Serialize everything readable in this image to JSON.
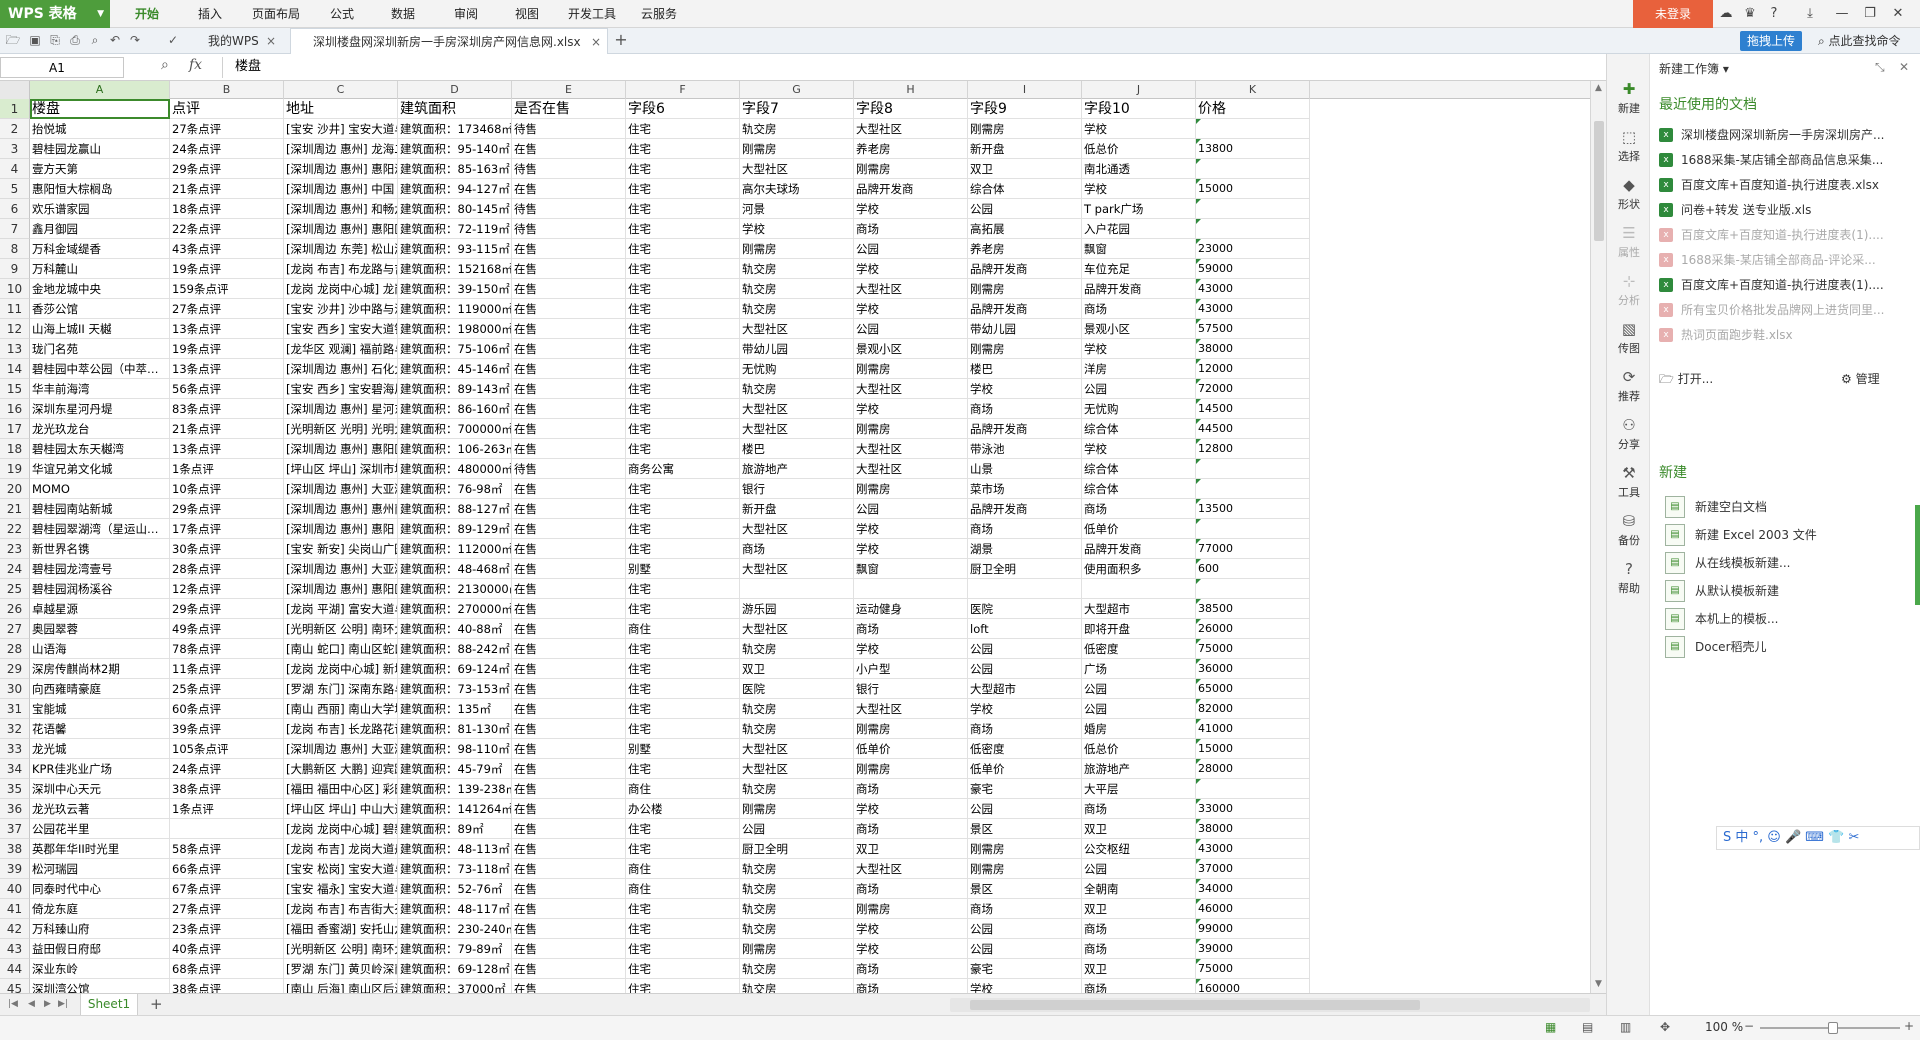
{
  "app": {
    "name": "WPS 表格",
    "login": "未登录",
    "upload": "拖拽上传",
    "find_cmd": "点此查找命令"
  },
  "menus": [
    "开始",
    "插入",
    "页面布局",
    "公式",
    "数据",
    "审阅",
    "视图",
    "开发工具",
    "云服务"
  ],
  "tabs": [
    {
      "label": "我的WPS"
    },
    {
      "label": "深圳楼盘网深圳新房一手房深圳房产网信息网.xlsx"
    }
  ],
  "formula": {
    "cell": "A1",
    "fx": "fx",
    "value": "楼盘"
  },
  "columns": [
    "A",
    "B",
    "C",
    "D",
    "E",
    "F",
    "G",
    "H",
    "I",
    "J",
    "K"
  ],
  "header_row": [
    "楼盘",
    "点评",
    "地址",
    "建筑面积",
    "是否在售",
    "字段6",
    "字段7",
    "字段8",
    "字段9",
    "字段10",
    "价格"
  ],
  "rows": [
    [
      "抬悦城",
      "27条点评",
      "[宝安 沙井] 宝安大道与创",
      "建筑面积：173468㎡",
      "待售",
      "住宅",
      "轨交房",
      "大型社区",
      "刚需房",
      "学校",
      ""
    ],
    [
      "碧桂园龙赢山",
      "24条点评",
      "[深圳周边 惠州] 龙海二路",
      "建筑面积：95-140㎡",
      "在售",
      "住宅",
      "刚需房",
      "养老房",
      "新开盘",
      "低总价",
      "13800"
    ],
    [
      "壹方天第",
      "29条点评",
      "[深圳周边 惠州] 惠阳淡水",
      "建筑面积：85-163㎡",
      "待售",
      "住宅",
      "大型社区",
      "刚需房",
      "双卫",
      "南北通透",
      ""
    ],
    [
      "惠阳恒大棕榈岛",
      "21条点评",
      "[深圳周边 惠州] 中国 惠阳",
      "建筑面积：94-127㎡",
      "在售",
      "住宅",
      "高尔夫球场",
      "品牌开发商",
      "综合体",
      "学校",
      "15000"
    ],
    [
      "欢乐谱家园",
      "18条点评",
      "[深圳周边 惠州] 和畅六路",
      "建筑面积：80-145㎡",
      "待售",
      "住宅",
      "河景",
      "学校",
      "公园",
      "T park广场",
      ""
    ],
    [
      "鑫月御园",
      "22条点评",
      "[深圳周边 惠州] 惠阳区北",
      "建筑面积：72-119㎡",
      "待售",
      "住宅",
      "学校",
      "商场",
      "高拓展",
      "入户花园",
      ""
    ],
    [
      "万科金域缇香",
      "43条点评",
      "[深圳周边 东莞] 松山湖科",
      "建筑面积：93-115㎡",
      "在售",
      "住宅",
      "刚需房",
      "公园",
      "养老房",
      "飘窗",
      "23000"
    ],
    [
      "万科麓山",
      "19条点评",
      "[龙岗 布吉] 布龙路与吉华",
      "建筑面积：152168㎡",
      "在售",
      "住宅",
      "轨交房",
      "学校",
      "品牌开发商",
      "车位充足",
      "59000"
    ],
    [
      "金地龙城中央",
      "159条点评",
      "[龙岗 龙岗中心城] 龙岗大",
      "建筑面积：39-150㎡",
      "在售",
      "住宅",
      "轨交房",
      "大型社区",
      "刚需房",
      "品牌开发商",
      "43000"
    ],
    [
      "香莎公馆",
      "27条点评",
      "[宝安 沙井] 沙中路与沙井",
      "建筑面积：119000㎡",
      "在售",
      "住宅",
      "轨交房",
      "学校",
      "品牌开发商",
      "商场",
      "43000"
    ],
    [
      "山海上城II 天樾",
      "13条点评",
      "[宝安 西乡] 宝安大道铁仔",
      "建筑面积：198000㎡",
      "在售",
      "住宅",
      "大型社区",
      "公园",
      "带幼儿园",
      "景观小区",
      "57500"
    ],
    [
      "珑门名苑",
      "19条点评",
      "[龙华区 观澜] 福前路与观",
      "建筑面积：75-106㎡",
      "在售",
      "住宅",
      "带幼儿园",
      "景观小区",
      "刚需房",
      "学校",
      "38000"
    ],
    [
      "碧桂园中萃公园（中萃…",
      "13条点评",
      "[深圳周边 惠州] 石化大道",
      "建筑面积：45-146㎡",
      "在售",
      "住宅",
      "无忧购",
      "刚需房",
      "楼巴",
      "洋房",
      "12000"
    ],
    [
      "华丰前海湾",
      "56条点评",
      "[宝安 西乡] 宝安碧海片区",
      "建筑面积：89-143㎡",
      "在售",
      "住宅",
      "轨交房",
      "大型社区",
      "学校",
      "公园",
      "72000"
    ],
    [
      "深圳东星河丹堤",
      "83条点评",
      "[深圳周边 惠州] 星河东七",
      "建筑面积：86-160㎡",
      "在售",
      "住宅",
      "大型社区",
      "学校",
      "商场",
      "无忧购",
      "14500"
    ],
    [
      "龙光玖龙台",
      "21条点评",
      "[光明新区 光明] 光明大道",
      "建筑面积：700000㎡",
      "在售",
      "住宅",
      "大型社区",
      "刚需房",
      "品牌开发商",
      "综合体",
      "44500"
    ],
    [
      "碧桂园太东天樾湾",
      "13条点评",
      "[深圳周边 惠州] 惠阳区大",
      "建筑面积：106-263㎡",
      "在售",
      "住宅",
      "楼巴",
      "大型社区",
      "带泳池",
      "学校",
      "12800"
    ],
    [
      "华谊兄弟文化城",
      "1条点评",
      "[坪山区 坪山] 深圳市坪山",
      "建筑面积：480000㎡",
      "待售",
      "商务公寓",
      "旅游地产",
      "大型社区",
      "山景",
      "综合体",
      ""
    ],
    [
      "MOMO",
      "10条点评",
      "[深圳周边 惠州] 大亚湾区",
      "建筑面积：76-98㎡",
      "在售",
      "住宅",
      "银行",
      "刚需房",
      "菜市场",
      "综合体",
      ""
    ],
    [
      "碧桂园南站新城",
      "29条点评",
      "[深圳周边 惠州] 惠州南站",
      "建筑面积：88-127㎡",
      "在售",
      "住宅",
      "新开盘",
      "公园",
      "品牌开发商",
      "商场",
      "13500"
    ],
    [
      "碧桂园翠湖湾（星运山…",
      "17条点评",
      "[深圳周边 惠州] 惠阳 新圩",
      "建筑面积：89-129㎡",
      "在售",
      "住宅",
      "大型社区",
      "学校",
      "商场",
      "低单价",
      ""
    ],
    [
      "新世界名镌",
      "30条点评",
      "[宝安 新安] 尖岗山广园路",
      "建筑面积：112000㎡",
      "在售",
      "住宅",
      "商场",
      "学校",
      "湖景",
      "品牌开发商",
      "77000"
    ],
    [
      "碧桂园龙湾壹号",
      "28条点评",
      "[深圳周边 惠州] 大亚湾西",
      "建筑面积：48-468㎡",
      "在售",
      "别墅",
      "大型社区",
      "飘窗",
      "厨卫全明",
      "使用面积多",
      "600"
    ],
    [
      "碧桂园润杨溪谷",
      "12条点评",
      "[深圳周边 惠州] 惠阳区深",
      "建筑面积：2130000㎡",
      "在售",
      "住宅",
      "",
      "",
      "",
      "",
      ""
    ],
    [
      "卓越星源",
      "29条点评",
      "[龙岗 平湖] 富安大道与新",
      "建筑面积：270000㎡",
      "在售",
      "住宅",
      "游乐园",
      "运动健身",
      "医院",
      "大型超市",
      "38500"
    ],
    [
      "奥园翠蓉",
      "49条点评",
      "[光明新区 公明] 南环大道",
      "建筑面积：40-88㎡",
      "在售",
      "商住",
      "大型社区",
      "商场",
      "loft",
      "即将开盘",
      "26000"
    ],
    [
      "山语海",
      "78条点评",
      "[南山 蛇口] 南山区蛇口沿",
      "建筑面积：88-242㎡",
      "在售",
      "住宅",
      "轨交房",
      "学校",
      "公园",
      "低密度",
      "75000"
    ],
    [
      "深房传麒尚林2期",
      "11条点评",
      "[龙岗 龙岗中心城] 新城路",
      "建筑面积：69-124㎡",
      "在售",
      "住宅",
      "双卫",
      "小户型",
      "公园",
      "广场",
      "36000"
    ],
    [
      "向西雍晴豪庭",
      "25条点评",
      "[罗湖 东门] 深南东路与东",
      "建筑面积：73-153㎡",
      "在售",
      "住宅",
      "医院",
      "银行",
      "大型超市",
      "公园",
      "65000"
    ],
    [
      "宝能城",
      "60条点评",
      "[南山 西丽] 南山大学城地",
      "建筑面积：135㎡",
      "在售",
      "住宅",
      "轨交房",
      "大型社区",
      "学校",
      "公园",
      "82000"
    ],
    [
      "花语馨",
      "39条点评",
      "[龙岗 布吉] 长龙路花语路",
      "建筑面积：81-130㎡",
      "在售",
      "住宅",
      "轨交房",
      "刚需房",
      "商场",
      "婚房",
      "41000"
    ],
    [
      "龙光城",
      "105条点评",
      "[深圳周边 惠州] 大亚湾西",
      "建筑面积：98-110㎡",
      "在售",
      "别墅",
      "大型社区",
      "低单价",
      "低密度",
      "低总价",
      "15000"
    ],
    [
      "KPR佳兆业广场",
      "24条点评",
      "[大鹏新区 大鹏] 迎宾路与",
      "建筑面积：45-79㎡",
      "在售",
      "住宅",
      "大型社区",
      "刚需房",
      "低单价",
      "旅游地产",
      "28000"
    ],
    [
      "深圳中心天元",
      "38条点评",
      "[福田 福田中心区] 彩田路",
      "建筑面积：139-238㎡",
      "在售",
      "商住",
      "轨交房",
      "商场",
      "豪宅",
      "大平层",
      ""
    ],
    [
      "龙光玖云著",
      "1条点评",
      "[坪山区 坪山] 中山大道与",
      "建筑面积：141264㎡",
      "在售",
      "办公楼",
      "刚需房",
      "学校",
      "公园",
      "商场",
      "33000"
    ],
    [
      "公园花半里",
      "",
      "[龙岗 龙岗中心城] 碧新路",
      "建筑面积：89㎡",
      "在售",
      "住宅",
      "公园",
      "商场",
      "景区",
      "双卫",
      "38000"
    ],
    [
      "英郡年华II时光里",
      "58条点评",
      "[龙岗 布吉] 龙岗大道丹竹",
      "建筑面积：48-113㎡",
      "在售",
      "住宅",
      "厨卫全明",
      "双卫",
      "刚需房",
      "公交枢纽",
      "43000"
    ],
    [
      "松河瑞园",
      "66条点评",
      "[宝安 松岗] 宝安大道与河",
      "建筑面积：73-118㎡",
      "在售",
      "商住",
      "轨交房",
      "大型社区",
      "刚需房",
      "公园",
      "37000"
    ],
    [
      "同泰时代中心",
      "67条点评",
      "[宝安 福永] 宝安大道与福",
      "建筑面积：52-76㎡",
      "在售",
      "商住",
      "轨交房",
      "商场",
      "景区",
      "全朝南",
      "34000"
    ],
    [
      "倚龙东庭",
      "27条点评",
      "[龙岗 布吉] 布吉街大芬村",
      "建筑面积：48-117㎡",
      "在售",
      "住宅",
      "轨交房",
      "刚需房",
      "商场",
      "双卫",
      "46000"
    ],
    [
      "万科臻山府",
      "23条点评",
      "[福田 香蜜湖] 安托山六路",
      "建筑面积：230-240㎡",
      "在售",
      "住宅",
      "轨交房",
      "学校",
      "公园",
      "商场",
      "99000"
    ],
    [
      "益田假日府邸",
      "40条点评",
      "[光明新区 公明] 南环大道",
      "建筑面积：79-89㎡",
      "在售",
      "住宅",
      "刚需房",
      "学校",
      "公园",
      "商场",
      "39000"
    ],
    [
      "深业东岭",
      "68条点评",
      "[罗湖 东门] 黄贝岭深南东",
      "建筑面积：69-128㎡",
      "在售",
      "住宅",
      "轨交房",
      "商场",
      "豪宅",
      "双卫",
      "75000"
    ],
    [
      "深圳湾公馆",
      "38条点评",
      "[南山 后海] 南山区后海中",
      "建筑面积：37000㎡",
      "在售",
      "住宅",
      "轨交房",
      "商场",
      "学校",
      "商场",
      "160000"
    ]
  ],
  "sheet_tab": "Sheet1",
  "zoom": "100 %",
  "side_buttons": [
    "新建",
    "选择",
    "形状",
    "属性",
    "分析",
    "传图",
    "推荐",
    "分享",
    "工具",
    "备份",
    "帮助"
  ],
  "taskpane": {
    "title": "新建工作簿 ▾",
    "recent_title": "最近使用的文档",
    "recent": [
      {
        "label": "深圳楼盘网深圳新房一手房深圳房产..."
      },
      {
        "label": "1688采集-某店铺全部商品信息采集..."
      },
      {
        "label": "百度文库+百度知道-执行进度表.xlsx"
      },
      {
        "label": "问卷+转发 送专业版.xls"
      },
      {
        "label": "百度文库+百度知道-执行进度表(1)...."
      },
      {
        "label": "1688采集-某店铺全部商品-评论采..."
      },
      {
        "label": "百度文库+百度知道-执行进度表(1)...."
      },
      {
        "label": "所有宝贝价格批发品牌网上进货同里..."
      },
      {
        "label": "热词页面跑步鞋.xlsx"
      }
    ],
    "open": "打开...",
    "manage": "管理",
    "new_title": "新建",
    "new_items": [
      "新建空白文档",
      "新建 Excel 2003 文件",
      "从在线模板新建...",
      "从默认模板新建",
      "本机上的模板...",
      "Docer稻壳儿"
    ]
  }
}
